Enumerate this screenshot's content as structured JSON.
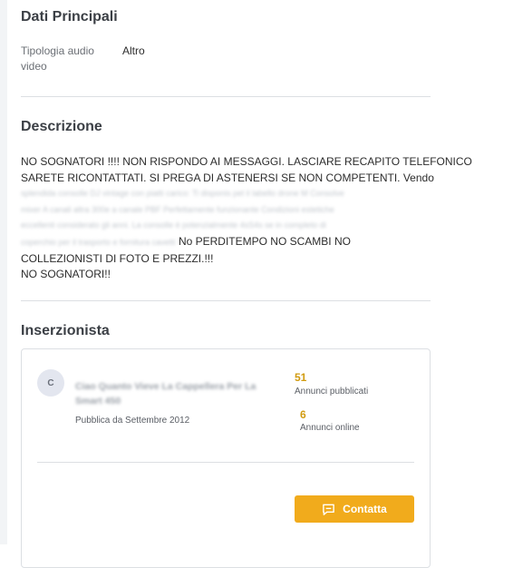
{
  "main_data": {
    "title": "Dati Principali",
    "field_label": "Tipologia audio video",
    "field_value": "Altro"
  },
  "description": {
    "title": "Descrizione",
    "line1": "NO SOGNATORI !!!! NON RISPONDO AI MESSAGGI. LASCIARE RECAPITO TELEFONICO",
    "line2": "SARETE RICONTATTATI. SI PREGA DI ASTENERSI SE NON COMPETENTI. Vendo",
    "blurred1": "splendida consolle DJ vintage con piatti carico: Ti disponis pel il labello drone M Consolve",
    "blurred2": "mixer A canali altra 300e a canale PBF Perfettamente funzionante Condizioni estetiche",
    "blurred3": "eccellenti considerato gli anni. La consolle è potenzialmente 4sS4s se in completo di",
    "blurred4": "coperchio per il trasporto e fornitura cavetti",
    "line5_end": "No PERDITEMPO NO SCAMBI NO",
    "line6": "COLLEZIONISTI DI FOTO E PREZZI.!!!",
    "line7": "NO SOGNATORI!!"
  },
  "advertiser": {
    "title": "Inserzionista",
    "avatar_initial": "C",
    "name": "Ciao Quanto Vieve La Cappellera Per La Smart 450",
    "since": "Pubblica da Settembre 2012",
    "published_count": "51",
    "published_label": "Annunci pubblicati",
    "online_count": "6",
    "online_label": "Annunci online",
    "contact_label": "Contatta",
    "contact_icon": "chat-bubble-icon",
    "accent_color": "#f1ab1c"
  }
}
